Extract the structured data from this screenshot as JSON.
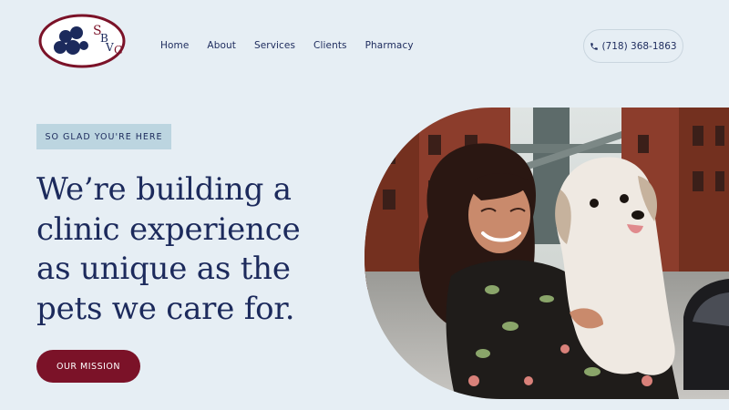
{
  "logo": {
    "letters": [
      "S",
      "B",
      "V",
      "G"
    ],
    "alt": "SBVG"
  },
  "nav": {
    "items": [
      "Home",
      "About",
      "Services",
      "Clients",
      "Pharmacy"
    ]
  },
  "phone": {
    "number": "(718) 368-1863",
    "icon": "phone-icon"
  },
  "hero": {
    "eyebrow": "SO GLAD YOU'RE HERE",
    "headline": [
      "We’re building a",
      "clinic experience",
      "as unique as the",
      "pets we care for."
    ],
    "cta_label": "OUR MISSION",
    "image_description": "Woman with long dark hair holding a small white fluffy dog on a city street with brick buildings and a bridge"
  },
  "colors": {
    "background": "#e6eef4",
    "navy": "#1c2a5c",
    "maroon": "#7b1228",
    "eyebrow_bg": "#bcd5e0"
  }
}
